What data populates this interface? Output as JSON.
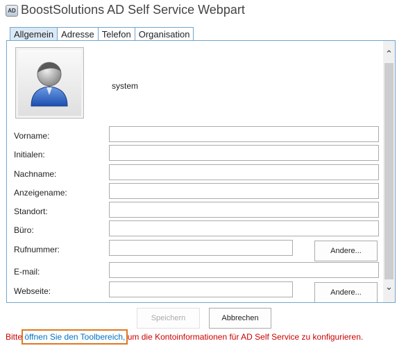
{
  "app": {
    "icon_text": "AD",
    "title": "BoostSolutions AD Self Service Webpart"
  },
  "tabs": [
    {
      "label": "Allgemein",
      "active": true
    },
    {
      "label": "Adresse",
      "active": false
    },
    {
      "label": "Telefon",
      "active": false
    },
    {
      "label": "Organisation",
      "active": false
    }
  ],
  "profile": {
    "username": "system"
  },
  "form": {
    "first_name": {
      "label": "Vorname:",
      "value": ""
    },
    "initials": {
      "label": "Initialen:",
      "value": ""
    },
    "last_name": {
      "label": "Nachname:",
      "value": ""
    },
    "display_name": {
      "label": "Anzeigename:",
      "value": ""
    },
    "location": {
      "label": "Standort:",
      "value": ""
    },
    "office": {
      "label": "Büro:",
      "value": ""
    },
    "phone": {
      "label": "Rufnummer:",
      "value": "",
      "other_label": "Andere..."
    },
    "email": {
      "label": "E-mail:",
      "value": ""
    },
    "website": {
      "label": "Webseite:",
      "value": "",
      "other_label": "Andere..."
    }
  },
  "actions": {
    "save_label": "Speichern",
    "save_enabled": false,
    "cancel_label": "Abbrechen"
  },
  "message": {
    "prefix": "Bitte",
    "link": "öffnen Sie den Toolbereich,",
    "suffix": "um die Kontoinformationen für AD Self Service zu konfigurieren."
  },
  "colors": {
    "border_accent": "#6fa5cf",
    "active_tab": "#dbe9f6",
    "error_text": "#cc0000",
    "link_text": "#0072c6",
    "focus_outline": "#e07820"
  }
}
